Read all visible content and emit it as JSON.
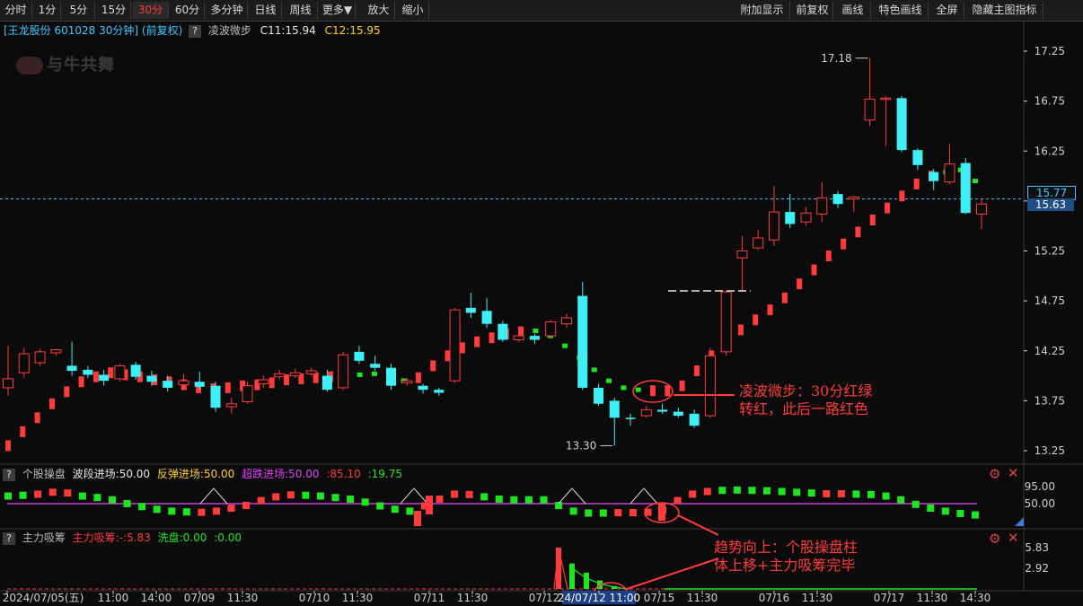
{
  "toolbar": {
    "left": [
      "分时",
      "1分",
      "5分",
      "15分",
      "30分",
      "60分",
      "多分钟",
      "日线",
      "周线",
      "更多▼",
      "放大",
      "缩小"
    ],
    "active": "30分",
    "right": [
      "附加显示",
      "前复权",
      "画线",
      "特色画线",
      "全屏",
      "隐藏主图指标"
    ]
  },
  "header": {
    "stock": "[王龙股份 601028 30分钟] (前复权)",
    "indicator": "凌波微步",
    "c1": "C11:15.94",
    "c2": "C12:15.95",
    "logo": "与牛共舞"
  },
  "price_axis": [
    "17.25",
    "16.75",
    "16.25",
    "15.75",
    "15.25",
    "14.75",
    "14.25",
    "13.75",
    "13.25"
  ],
  "price_tags": {
    "current": "15.77",
    "last": "15.63"
  },
  "extremes": {
    "high": "17.18",
    "low": "13.30"
  },
  "annotations": {
    "a1_line1": "凌波微步：30分红绿",
    "a1_line2": "转红，此后一路红色",
    "a2_line1": "趋势向上：个股操盘柱",
    "a2_line2": "体上移+主力吸筹完毕"
  },
  "panel1": {
    "name": "个股操盘",
    "l1": "波段进场:50.00",
    "l2": "反弹进场:50.00",
    "l3": "超跌进场:50.00",
    "l4": ":85.10",
    "l5": ":19.75",
    "axis": [
      "95.00",
      "50.00"
    ]
  },
  "panel2": {
    "name": "主力吸筹",
    "l1": "主力吸筹:-",
    "l1b": ":5.83",
    "l2": "洗盘:0.00",
    "l3": ":0.00",
    "axis": [
      "5.83",
      "2.92"
    ]
  },
  "time_axis": [
    "2024/07/05(五)",
    "11:00",
    "14:00",
    "07/09",
    "11:30",
    "07/10",
    "11:30",
    "07/11",
    "11:30",
    "07/12",
    "24/07/12 11:00",
    "07/15",
    "11:30",
    "07/16",
    "11:30",
    "07/17",
    "11:30",
    "14:30"
  ],
  "colors": {
    "up": "#ff3b3b",
    "down": "#3ef0f6",
    "green": "#1ee61e",
    "purple": "#c23fd9",
    "axis": "#cfcfcf",
    "grid": "#3a3a3a"
  },
  "chart_data": {
    "type": "candlestick",
    "ylim": [
      13.1,
      17.4
    ],
    "candles": [
      {
        "o": 13.88,
        "c": 13.97,
        "h": 14.3,
        "l": 13.8
      },
      {
        "o": 14.03,
        "c": 14.22,
        "h": 14.28,
        "l": 13.98
      },
      {
        "o": 14.13,
        "c": 14.24,
        "h": 14.27,
        "l": 14.1
      },
      {
        "o": 14.23,
        "c": 14.26,
        "h": 14.27,
        "l": 14.2
      },
      {
        "o": 14.1,
        "c": 14.05,
        "h": 14.34,
        "l": 14.0
      },
      {
        "o": 14.06,
        "c": 14.01,
        "h": 14.1,
        "l": 13.98
      },
      {
        "o": 14.01,
        "c": 13.95,
        "h": 14.06,
        "l": 13.9
      },
      {
        "o": 13.97,
        "c": 14.1,
        "h": 14.12,
        "l": 13.94
      },
      {
        "o": 14.11,
        "c": 13.99,
        "h": 14.14,
        "l": 13.96
      },
      {
        "o": 14.0,
        "c": 13.94,
        "h": 14.05,
        "l": 13.9
      },
      {
        "o": 13.95,
        "c": 13.88,
        "h": 14.0,
        "l": 13.84
      },
      {
        "o": 13.91,
        "c": 13.95,
        "h": 14.02,
        "l": 13.88
      },
      {
        "o": 13.94,
        "c": 13.89,
        "h": 14.04,
        "l": 13.86
      },
      {
        "o": 13.9,
        "c": 13.68,
        "h": 13.94,
        "l": 13.64
      },
      {
        "o": 13.69,
        "c": 13.72,
        "h": 13.78,
        "l": 13.62
      },
      {
        "o": 13.74,
        "c": 13.9,
        "h": 13.94,
        "l": 13.72
      },
      {
        "o": 13.92,
        "c": 13.96,
        "h": 14.0,
        "l": 13.88
      },
      {
        "o": 13.99,
        "c": 14.02,
        "h": 14.06,
        "l": 13.96
      },
      {
        "o": 14.0,
        "c": 14.03,
        "h": 14.07,
        "l": 13.98
      },
      {
        "o": 14.02,
        "c": 14.05,
        "h": 14.08,
        "l": 14.0
      },
      {
        "o": 14.0,
        "c": 13.86,
        "h": 14.06,
        "l": 13.84
      },
      {
        "o": 13.88,
        "c": 14.21,
        "h": 14.24,
        "l": 13.86
      },
      {
        "o": 14.24,
        "c": 14.15,
        "h": 14.3,
        "l": 14.12
      },
      {
        "o": 14.12,
        "c": 14.08,
        "h": 14.2,
        "l": 14.05
      },
      {
        "o": 14.08,
        "c": 13.9,
        "h": 14.12,
        "l": 13.86
      },
      {
        "o": 13.93,
        "c": 13.95,
        "h": 13.98,
        "l": 13.9
      },
      {
        "o": 13.9,
        "c": 13.86,
        "h": 13.92,
        "l": 13.82
      },
      {
        "o": 13.86,
        "c": 13.83,
        "h": 13.88,
        "l": 13.8
      },
      {
        "o": 13.95,
        "c": 14.66,
        "h": 14.68,
        "l": 13.93
      },
      {
        "o": 14.68,
        "c": 14.63,
        "h": 14.83,
        "l": 14.58
      },
      {
        "o": 14.65,
        "c": 14.52,
        "h": 14.78,
        "l": 14.48
      },
      {
        "o": 14.52,
        "c": 14.36,
        "h": 14.55,
        "l": 14.34
      },
      {
        "o": 14.36,
        "c": 14.4,
        "h": 14.5,
        "l": 14.34
      },
      {
        "o": 14.4,
        "c": 14.36,
        "h": 14.42,
        "l": 14.32
      },
      {
        "o": 14.4,
        "c": 14.54,
        "h": 14.56,
        "l": 14.38
      },
      {
        "o": 14.52,
        "c": 14.58,
        "h": 14.62,
        "l": 14.48
      },
      {
        "o": 14.8,
        "c": 13.88,
        "h": 14.94,
        "l": 13.86
      },
      {
        "o": 13.88,
        "c": 13.72,
        "h": 13.92,
        "l": 13.7
      },
      {
        "o": 13.75,
        "c": 13.58,
        "h": 13.78,
        "l": 13.3
      },
      {
        "o": 13.58,
        "c": 13.57,
        "h": 13.62,
        "l": 13.5
      },
      {
        "o": 13.6,
        "c": 13.66,
        "h": 13.7,
        "l": 13.58
      },
      {
        "o": 13.66,
        "c": 13.64,
        "h": 13.72,
        "l": 13.62
      },
      {
        "o": 13.64,
        "c": 13.6,
        "h": 13.68,
        "l": 13.58
      },
      {
        "o": 13.62,
        "c": 13.5,
        "h": 13.66,
        "l": 13.48
      },
      {
        "o": 13.6,
        "c": 14.2,
        "h": 14.28,
        "l": 13.58
      },
      {
        "o": 14.24,
        "c": 14.84,
        "h": 14.85,
        "l": 14.2
      },
      {
        "o": 15.18,
        "c": 15.25,
        "h": 15.4,
        "l": 14.84
      },
      {
        "o": 15.28,
        "c": 15.38,
        "h": 15.46,
        "l": 15.26
      },
      {
        "o": 15.36,
        "c": 15.64,
        "h": 15.9,
        "l": 15.3
      },
      {
        "o": 15.64,
        "c": 15.52,
        "h": 15.82,
        "l": 15.48
      },
      {
        "o": 15.54,
        "c": 15.63,
        "h": 15.69,
        "l": 15.5
      },
      {
        "o": 15.62,
        "c": 15.78,
        "h": 15.94,
        "l": 15.54
      },
      {
        "o": 15.82,
        "c": 15.72,
        "h": 15.85,
        "l": 15.68
      },
      {
        "o": 15.77,
        "c": 15.79,
        "h": 15.8,
        "l": 15.64
      },
      {
        "o": 16.56,
        "c": 16.77,
        "h": 17.18,
        "l": 16.5
      },
      {
        "o": 16.77,
        "c": 16.78,
        "h": 16.8,
        "l": 16.3
      },
      {
        "o": 16.78,
        "c": 16.26,
        "h": 16.8,
        "l": 16.24
      },
      {
        "o": 16.26,
        "c": 16.11,
        "h": 16.28,
        "l": 16.06
      },
      {
        "o": 16.04,
        "c": 15.95,
        "h": 16.07,
        "l": 15.86
      },
      {
        "o": 15.94,
        "c": 16.12,
        "h": 16.32,
        "l": 15.92
      },
      {
        "o": 16.13,
        "c": 15.63,
        "h": 16.18,
        "l": 15.62
      },
      {
        "o": 15.62,
        "c": 15.72,
        "h": 15.77,
        "l": 15.47
      }
    ],
    "lingbo": [
      {
        "v": 13.3,
        "c": "r"
      },
      {
        "v": 13.44,
        "c": "r"
      },
      {
        "v": 13.58,
        "c": "r"
      },
      {
        "v": 13.72,
        "c": "r"
      },
      {
        "v": 13.84,
        "c": "r"
      },
      {
        "v": 13.94,
        "c": "r"
      },
      {
        "v": 13.99,
        "c": "r"
      },
      {
        "v": 14.03,
        "c": "r"
      },
      {
        "v": 14.01,
        "c": "r"
      },
      {
        "v": 13.99,
        "c": "r"
      },
      {
        "v": 13.96,
        "c": "r"
      },
      {
        "v": 13.94,
        "c": "r"
      },
      {
        "v": 13.91,
        "c": "r"
      },
      {
        "v": 13.88,
        "c": "r"
      },
      {
        "v": 13.87,
        "c": "r"
      },
      {
        "v": 13.88,
        "c": "r"
      },
      {
        "v": 13.9,
        "c": "r"
      },
      {
        "v": 13.91,
        "c": "r"
      },
      {
        "v": 13.93,
        "c": "r"
      },
      {
        "v": 13.96,
        "c": "r"
      },
      {
        "v": 13.97,
        "c": "r"
      },
      {
        "v": 13.98,
        "c": "r"
      },
      {
        "v": 13.99,
        "c": "r"
      },
      {
        "v": 14.0,
        "c": "r"
      },
      {
        "v": 14.01,
        "c": "g"
      },
      {
        "v": 14.02,
        "c": "g"
      },
      {
        "v": 13.96,
        "c": "g"
      },
      {
        "v": 13.95,
        "c": "g"
      },
      {
        "v": 13.98,
        "c": "r"
      },
      {
        "v": 14.1,
        "c": "r"
      },
      {
        "v": 14.2,
        "c": "r"
      },
      {
        "v": 14.28,
        "c": "r"
      },
      {
        "v": 14.34,
        "c": "r"
      },
      {
        "v": 14.38,
        "c": "r"
      },
      {
        "v": 14.42,
        "c": "r"
      },
      {
        "v": 14.44,
        "c": "r"
      },
      {
        "v": 14.45,
        "c": "g"
      },
      {
        "v": 14.4,
        "c": "g"
      },
      {
        "v": 14.3,
        "c": "g"
      },
      {
        "v": 14.18,
        "c": "g"
      },
      {
        "v": 14.06,
        "c": "g"
      },
      {
        "v": 13.95,
        "c": "g"
      },
      {
        "v": 13.88,
        "c": "g"
      },
      {
        "v": 13.86,
        "c": "g"
      },
      {
        "v": 13.85,
        "c": "r"
      },
      {
        "v": 13.85,
        "c": "r"
      },
      {
        "v": 13.9,
        "c": "r"
      },
      {
        "v": 14.05,
        "c": "r"
      },
      {
        "v": 14.2,
        "c": "r"
      },
      {
        "v": 14.34,
        "c": "r"
      },
      {
        "v": 14.46,
        "c": "r"
      },
      {
        "v": 14.56,
        "c": "r"
      },
      {
        "v": 14.66,
        "c": "r"
      },
      {
        "v": 14.78,
        "c": "r"
      },
      {
        "v": 14.92,
        "c": "r"
      },
      {
        "v": 15.06,
        "c": "r"
      },
      {
        "v": 15.2,
        "c": "r"
      },
      {
        "v": 15.32,
        "c": "r"
      },
      {
        "v": 15.44,
        "c": "r"
      },
      {
        "v": 15.56,
        "c": "r"
      },
      {
        "v": 15.68,
        "c": "r"
      },
      {
        "v": 15.8,
        "c": "r"
      },
      {
        "v": 15.92,
        "c": "r"
      },
      {
        "v": 16.0,
        "c": "r"
      },
      {
        "v": 16.04,
        "c": "g"
      },
      {
        "v": 16.06,
        "c": "g"
      },
      {
        "v": 15.95,
        "c": "g"
      }
    ],
    "panel1_bars": [
      {
        "v": 70,
        "c": "g"
      },
      {
        "v": 72,
        "c": "g"
      },
      {
        "v": 75,
        "c": "r"
      },
      {
        "v": 80,
        "c": "r"
      },
      {
        "v": 78,
        "c": "r"
      },
      {
        "v": 70,
        "c": "g"
      },
      {
        "v": 66,
        "c": "g"
      },
      {
        "v": 60,
        "c": "g"
      },
      {
        "v": 50,
        "c": "g"
      },
      {
        "v": 42,
        "c": "g"
      },
      {
        "v": 35,
        "c": "g"
      },
      {
        "v": 30,
        "c": "g"
      },
      {
        "v": 28,
        "c": "g"
      },
      {
        "v": 27,
        "c": "r"
      },
      {
        "v": 30,
        "c": "r"
      },
      {
        "v": 38,
        "c": "r"
      },
      {
        "v": 45,
        "c": "r"
      },
      {
        "v": 58,
        "c": "r"
      },
      {
        "v": 68,
        "c": "r"
      },
      {
        "v": 73,
        "c": "r"
      },
      {
        "v": 72,
        "c": "g"
      },
      {
        "v": 70,
        "c": "g"
      },
      {
        "v": 66,
        "c": "g"
      },
      {
        "v": 62,
        "c": "g"
      },
      {
        "v": 54,
        "c": "g"
      },
      {
        "v": 44,
        "c": "g"
      },
      {
        "v": 35,
        "c": "g"
      },
      {
        "v": 30,
        "c": "g"
      },
      {
        "v": 44,
        "c": "r"
      },
      {
        "v": 62,
        "c": "r"
      },
      {
        "v": 75,
        "c": "r"
      },
      {
        "v": 74,
        "c": "r"
      },
      {
        "v": 68,
        "c": "g"
      },
      {
        "v": 62,
        "c": "g"
      },
      {
        "v": 60,
        "c": "g"
      },
      {
        "v": 60,
        "c": "g"
      },
      {
        "v": 60,
        "c": "g"
      },
      {
        "v": 45,
        "c": "g"
      },
      {
        "v": 30,
        "c": "g"
      },
      {
        "v": 25,
        "c": "g"
      },
      {
        "v": 25,
        "c": "g"
      },
      {
        "v": 26,
        "c": "r"
      },
      {
        "v": 26,
        "c": "r"
      },
      {
        "v": 27,
        "c": "r"
      },
      {
        "v": 32,
        "c": "r"
      },
      {
        "v": 58,
        "c": "r"
      },
      {
        "v": 75,
        "c": "r"
      },
      {
        "v": 82,
        "c": "r"
      },
      {
        "v": 85,
        "c": "g"
      },
      {
        "v": 86,
        "c": "g"
      },
      {
        "v": 85,
        "c": "g"
      },
      {
        "v": 84,
        "c": "g"
      },
      {
        "v": 82,
        "c": "g"
      },
      {
        "v": 80,
        "c": "g"
      },
      {
        "v": 78,
        "c": "g"
      },
      {
        "v": 76,
        "c": "r"
      },
      {
        "v": 76,
        "c": "r"
      },
      {
        "v": 75,
        "c": "g"
      },
      {
        "v": 74,
        "c": "g"
      },
      {
        "v": 70,
        "c": "g"
      },
      {
        "v": 60,
        "c": "g"
      },
      {
        "v": 48,
        "c": "g"
      },
      {
        "v": 38,
        "c": "g"
      },
      {
        "v": 30,
        "c": "g"
      },
      {
        "v": 24,
        "c": "g"
      },
      {
        "v": 20,
        "c": "g"
      }
    ],
    "panel1_tri_idx": [
      14,
      28,
      39,
      44
    ],
    "panel2_bars": [
      {
        "i": 38,
        "v": 5.83,
        "c": "r"
      },
      {
        "i": 39,
        "v": 3.6,
        "c": "g"
      },
      {
        "i": 40,
        "v": 2.3,
        "c": "g"
      },
      {
        "i": 41,
        "v": 1.2,
        "c": "g"
      },
      {
        "i": 42,
        "v": 0.4,
        "c": "g"
      }
    ]
  }
}
